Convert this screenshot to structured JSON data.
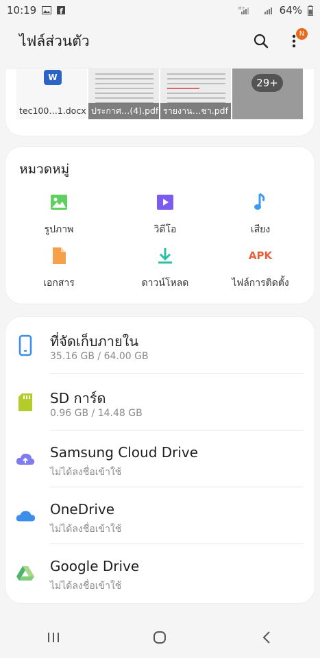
{
  "status": {
    "time": "10:19",
    "battery": "64%"
  },
  "appbar": {
    "title": "ไฟล์ส่วนตัว",
    "badge": "N"
  },
  "recent": [
    {
      "label": "tec100…1.docx",
      "kind": "docx"
    },
    {
      "label": "ประกาศ…(4).pdf",
      "kind": "pdf"
    },
    {
      "label": "รายงาน…ชา.pdf",
      "kind": "pdf"
    },
    {
      "label": "",
      "more": "29+",
      "kind": "more"
    }
  ],
  "categories": {
    "title": "หมวดหมู่",
    "items": [
      {
        "label": "รูปภาพ",
        "icon": "image-icon"
      },
      {
        "label": "วิดีโอ",
        "icon": "video-icon"
      },
      {
        "label": "เสียง",
        "icon": "music-icon"
      },
      {
        "label": "เอกสาร",
        "icon": "document-icon"
      },
      {
        "label": "ดาวน์โหลด",
        "icon": "download-icon"
      },
      {
        "label": "ไฟล์การติดตั้ง",
        "icon": "apk-icon",
        "glyph": "APK"
      }
    ]
  },
  "storage": [
    {
      "name": "ที่จัดเก็บภายใน",
      "sub": "35.16 GB / 64.00 GB",
      "icon": "phone-icon"
    },
    {
      "name": "SD การ์ด",
      "sub": "0.96 GB / 14.48 GB",
      "icon": "sd-card-icon"
    },
    {
      "name": "Samsung Cloud Drive",
      "sub": "ไม่ได้ลงชื่อเข้าใช้",
      "icon": "samsung-cloud-icon"
    },
    {
      "name": "OneDrive",
      "sub": "ไม่ได้ลงชื่อเข้าใช้",
      "icon": "onedrive-icon"
    },
    {
      "name": "Google Drive",
      "sub": "ไม่ได้ลงชื่อเข้าใช้",
      "icon": "google-drive-icon"
    }
  ],
  "colors": {
    "image": "#5fcf60",
    "video": "#7a5cf0",
    "audio": "#3d9cf0",
    "document": "#f5a04b",
    "download": "#2bbfa6",
    "apk": "#e8603a",
    "phone": "#3d8ee8",
    "sd": "#b4cc2a",
    "badge": "#e86a1c"
  }
}
